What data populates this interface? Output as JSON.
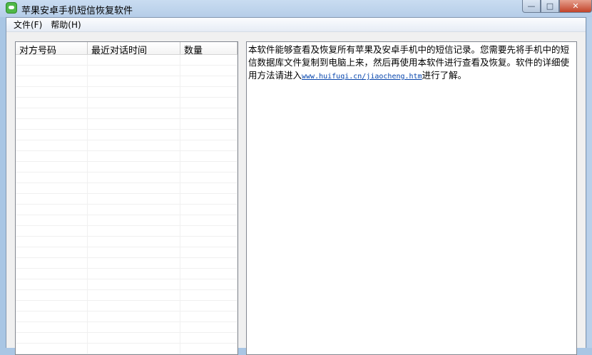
{
  "window": {
    "title": "苹果安卓手机短信恢复软件",
    "minimize": "—",
    "maximize": "□",
    "close": "✕"
  },
  "menu": [
    "文件(F)",
    "帮助(H)"
  ],
  "list": {
    "columns": [
      "对方号码",
      "最近对话时间",
      "数量"
    ],
    "rows": []
  },
  "info": {
    "text_before": "本软件能够查看及恢复所有苹果及安卓手机中的短信记录。您需要先将手机中的短信数据库文件复制到电脑上来，然后再使用本软件进行查看及恢复。软件的详细使用方法请进入",
    "link": "www.huifuqi.cn/jiaocheng.htm",
    "text_after": "进行了解。"
  }
}
